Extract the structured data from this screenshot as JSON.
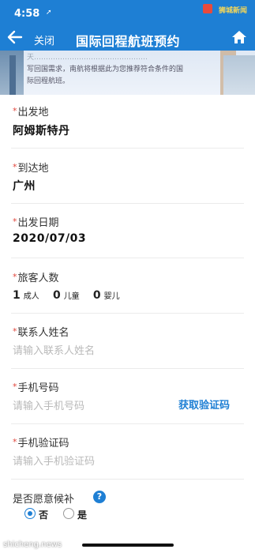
{
  "status_bar": {
    "time": "4:58",
    "location_arrow": "➚",
    "watermark": "狮城新闻"
  },
  "nav": {
    "close_label": "关闭",
    "title": "国际回程航班预约"
  },
  "banner": {
    "line1": "天…………………………………………",
    "line2": "写回国需求，南航将根据此为您推荐符合条件的国",
    "line3": "际回程航班。"
  },
  "form": {
    "origin": {
      "label": "出发地",
      "value": "阿姆斯特丹"
    },
    "destination": {
      "label": "到达地",
      "value": "广州"
    },
    "date": {
      "label": "出发日期",
      "value": "2020/07/03"
    },
    "passengers": {
      "label": "旅客人数",
      "adult_count": "1",
      "adult_label": "成人",
      "child_count": "0",
      "child_label": "儿童",
      "infant_count": "0",
      "infant_label": "婴儿"
    },
    "contact_name": {
      "label": "联系人姓名",
      "placeholder": "请输入联系人姓名"
    },
    "phone": {
      "label": "手机号码",
      "placeholder": "请输入手机号码",
      "otp_button": "获取验证码"
    },
    "otp": {
      "label": "手机验证码",
      "placeholder": "请输入手机验证码"
    },
    "standby": {
      "label": "是否愿意候补",
      "help": "?",
      "option_no": "否",
      "option_yes": "是",
      "selected": "否"
    }
  },
  "required_mark": "*",
  "footer_watermark": "shicheng.news",
  "colors": {
    "brand": "#1e7fd4",
    "required": "#e0463c",
    "placeholder": "#b9b9b9"
  },
  "icons": {
    "back": "arrow-left-icon",
    "home": "home-icon",
    "help": "question-icon"
  }
}
